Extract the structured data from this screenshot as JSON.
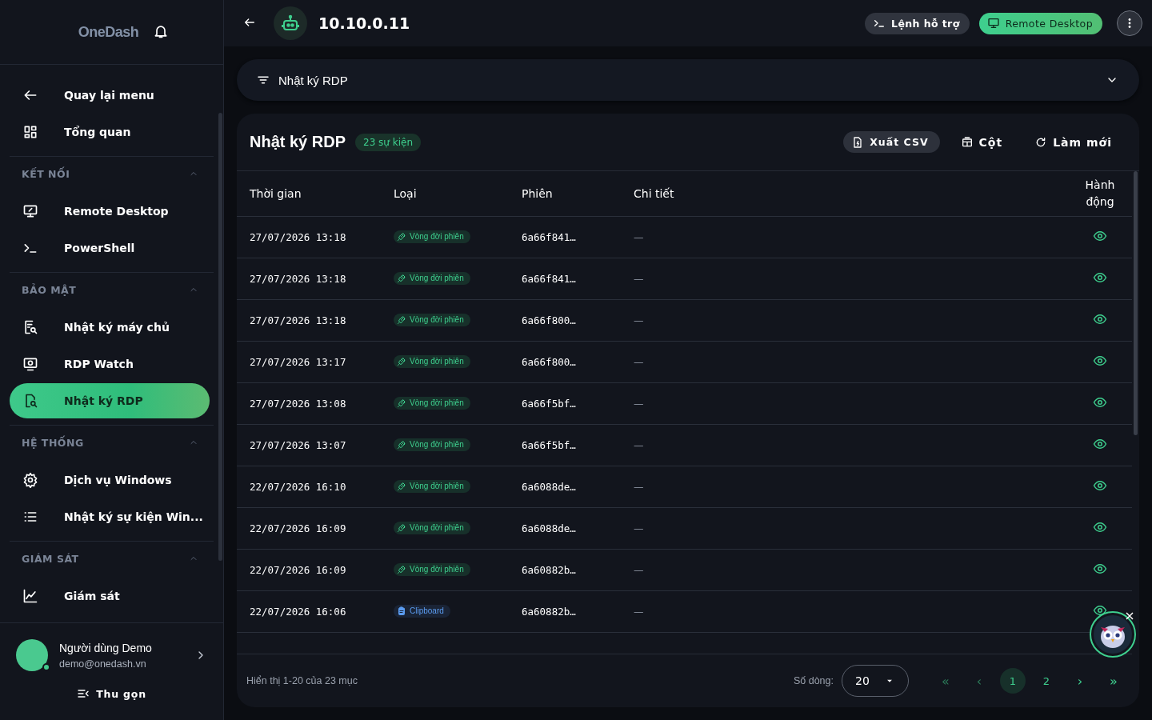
{
  "sidebar": {
    "brand": "OneDash",
    "items": [
      {
        "label": "Quay lại menu",
        "kind": "back",
        "selected": false
      },
      {
        "label": "Tổng quan",
        "kind": "grid",
        "selected": false
      }
    ],
    "sections": [
      {
        "title": "KẾT NỐI",
        "expanded": true,
        "items": [
          {
            "label": "Remote Desktop",
            "kind": "monitor",
            "selected": false
          },
          {
            "label": "PowerShell",
            "kind": "prompt",
            "selected": false
          }
        ]
      },
      {
        "title": "BẢO MẬT",
        "expanded": true,
        "items": [
          {
            "label": "Nhật ký máy chủ",
            "kind": "logsearch",
            "selected": false
          },
          {
            "label": "RDP Watch",
            "kind": "watch",
            "selected": false
          },
          {
            "label": "Nhật ký RDP",
            "kind": "docsearch",
            "selected": true
          }
        ]
      },
      {
        "title": "HỆ THỐNG",
        "expanded": true,
        "items": [
          {
            "label": "Dịch vụ Windows",
            "kind": "gear",
            "selected": false
          },
          {
            "label": "Nhật ký sự kiện Win...",
            "kind": "list",
            "selected": false
          }
        ]
      },
      {
        "title": "GIÁM SÁT",
        "expanded": true,
        "items": [
          {
            "label": "Giám sát",
            "kind": "chart",
            "selected": false
          }
        ]
      }
    ],
    "user": {
      "name": "Người dùng Demo",
      "email": "demo@onedash.vn",
      "online": true
    },
    "collapse": "Thu gọn"
  },
  "topbar": {
    "title": "10.10.0.11",
    "buttons": [
      {
        "label": "Lệnh hỗ trợ",
        "kind": "secondary"
      },
      {
        "label": "Remote Desktop",
        "kind": "primary"
      }
    ]
  },
  "filter": {
    "label": "Nhật ký RDP",
    "expanded": false
  },
  "panel": {
    "title": "Nhật ký RDP",
    "count": "23 sự kiện",
    "actions": [
      {
        "label": "Xuất CSV",
        "kind": "csv"
      },
      {
        "label": "Cột",
        "kind": "columns"
      },
      {
        "label": "Làm mới",
        "kind": "refresh"
      }
    ]
  },
  "table": {
    "columns": [
      "Thời gian",
      "Loại",
      "Phiên",
      "Chi tiết",
      "Hành động"
    ],
    "rows": [
      {
        "time": "27/07/2026 13:18",
        "type": "Vòng đời phiên",
        "kind": "session",
        "session": "6a66f841…",
        "detail": "—"
      },
      {
        "time": "27/07/2026 13:18",
        "type": "Vòng đời phiên",
        "kind": "session",
        "session": "6a66f841…",
        "detail": "—"
      },
      {
        "time": "27/07/2026 13:18",
        "type": "Vòng đời phiên",
        "kind": "session",
        "session": "6a66f800…",
        "detail": "—"
      },
      {
        "time": "27/07/2026 13:17",
        "type": "Vòng đời phiên",
        "kind": "session",
        "session": "6a66f800…",
        "detail": "—"
      },
      {
        "time": "27/07/2026 13:08",
        "type": "Vòng đời phiên",
        "kind": "session",
        "session": "6a66f5bf…",
        "detail": "—"
      },
      {
        "time": "27/07/2026 13:07",
        "type": "Vòng đời phiên",
        "kind": "session",
        "session": "6a66f5bf…",
        "detail": "—"
      },
      {
        "time": "22/07/2026 16:10",
        "type": "Vòng đời phiên",
        "kind": "session",
        "session": "6a6088de…",
        "detail": "—"
      },
      {
        "time": "22/07/2026 16:09",
        "type": "Vòng đời phiên",
        "kind": "session",
        "session": "6a6088de…",
        "detail": "—"
      },
      {
        "time": "22/07/2026 16:09",
        "type": "Vòng đời phiên",
        "kind": "session",
        "session": "6a60882b…",
        "detail": "—"
      },
      {
        "time": "22/07/2026 16:06",
        "type": "Clipboard",
        "kind": "clipboard",
        "session": "6a60882b…",
        "detail": "—"
      }
    ]
  },
  "footer": {
    "summary": "Hiển thị 1-20 của 23 mục",
    "rows_label": "Số dòng:",
    "rows_value": "20",
    "pages": [
      {
        "label": "«",
        "kind": "first"
      },
      {
        "label": "‹",
        "kind": "prev"
      },
      {
        "label": "1",
        "kind": "page",
        "selected": true
      },
      {
        "label": "2",
        "kind": "page",
        "selected": false
      },
      {
        "label": "›",
        "kind": "next"
      },
      {
        "label": "»",
        "kind": "last"
      }
    ]
  }
}
